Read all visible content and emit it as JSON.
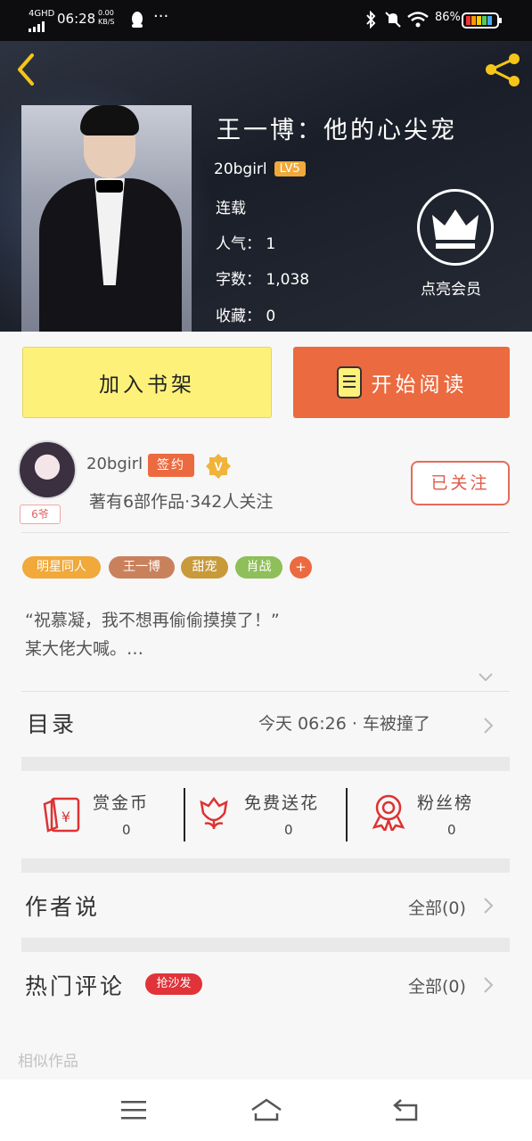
{
  "status_bar": {
    "network": "4GHD",
    "time": "06:28",
    "speed": "0.00 KB/S",
    "battery": "86%"
  },
  "book": {
    "title": "王一博：他的心尖宠",
    "author": "20bgirl",
    "level": "LV5",
    "status": "连载",
    "popularity_label": "人气：",
    "popularity": "1",
    "word_count_label": "字数：",
    "word_count": "1,038",
    "favorites_label": "收藏：",
    "favorites": "0",
    "vip_label": "点亮会员"
  },
  "actions": {
    "add_shelf": "加入书架",
    "start_read": "开始阅读"
  },
  "author": {
    "name": "20bgirl",
    "signed": "签约",
    "tag": "6爷",
    "stats": "著有6部作品·342人关注",
    "follow": "已关注"
  },
  "tags": [
    {
      "label": "明星同人",
      "color": "#f0a93a"
    },
    {
      "label": "王一博",
      "color": "#c9815c"
    },
    {
      "label": "甜宠",
      "color": "#c89a3a"
    },
    {
      "label": "肖战",
      "color": "#8fbf5a"
    }
  ],
  "tag_more": "+",
  "synopsis": "“祝慕凝，我不想再偷偷摸摸了！”\n某大佬大喊。…",
  "catalog": {
    "title": "目录",
    "latest": "今天 06:26 · 车被撞了"
  },
  "stats": [
    {
      "label": "赏金币",
      "value": "0",
      "icon": "red-envelope-icon"
    },
    {
      "label": "免费送花",
      "value": "0",
      "icon": "flower-icon"
    },
    {
      "label": "粉丝榜",
      "value": "0",
      "icon": "ribbon-medal-icon"
    }
  ],
  "author_says": {
    "title": "作者说",
    "all": "全部(0)"
  },
  "hot_comments": {
    "title": "热门评论",
    "badge": "抢沙发",
    "all": "全部(0)"
  },
  "similar": "相似作品"
}
